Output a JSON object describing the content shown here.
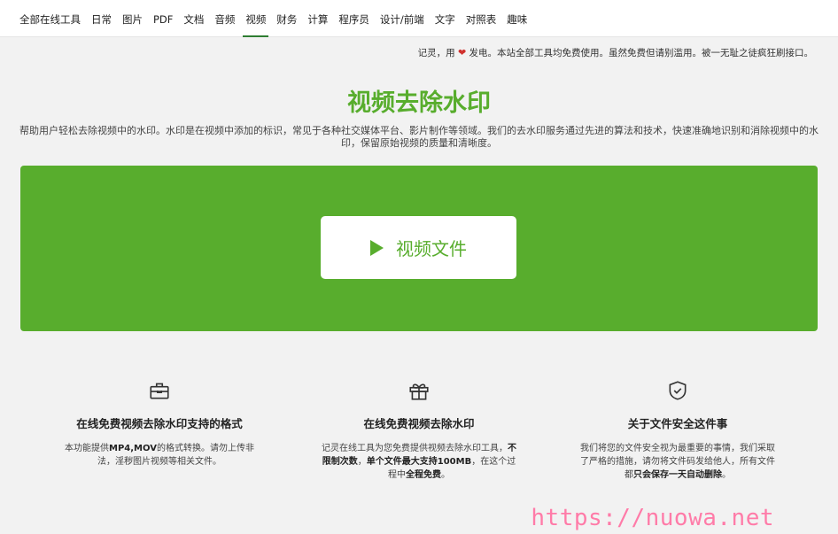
{
  "nav": {
    "items": [
      {
        "label": "全部在线工具"
      },
      {
        "label": "日常"
      },
      {
        "label": "图片"
      },
      {
        "label": "PDF"
      },
      {
        "label": "文档"
      },
      {
        "label": "音频"
      },
      {
        "label": "视频",
        "active": true
      },
      {
        "label": "财务"
      },
      {
        "label": "计算"
      },
      {
        "label": "程序员"
      },
      {
        "label": "设计/前端"
      },
      {
        "label": "文字"
      },
      {
        "label": "对照表"
      },
      {
        "label": "趣味"
      }
    ]
  },
  "notice": {
    "prefix": "记灵，用",
    "suffix": "发电。本站全部工具均免费使用。虽然免费但请别滥用。被一无耻之徒疯狂刷接口。"
  },
  "page": {
    "title": "视频去除水印",
    "description": "帮助用户轻松去除视频中的水印。水印是在视频中添加的标识，常见于各种社交媒体平台、影片制作等领域。我们的去水印服务通过先进的算法和技术，快速准确地识别和消除视频中的水印，保留原始视频的质量和清晰度。"
  },
  "upload": {
    "label": "视频文件"
  },
  "features": [
    {
      "icon": "toolbox-icon",
      "title": "在线免费视频去除水印支持的格式",
      "text_parts": [
        {
          "t": "本功能提供",
          "b": false
        },
        {
          "t": "MP4,MOV",
          "b": true
        },
        {
          "t": "的格式转换。请勿上传非法，淫秽图片视频等相关文件。",
          "b": false
        }
      ]
    },
    {
      "icon": "gift-icon",
      "title": "在线免费视频去除水印",
      "text_parts": [
        {
          "t": "记灵在线工具为您免费提供视频去除水印工具，",
          "b": false
        },
        {
          "t": "不限制次数",
          "b": true
        },
        {
          "t": "，",
          "b": false
        },
        {
          "t": "单个文件最大支持100MB",
          "b": true
        },
        {
          "t": "，在这个过程中",
          "b": false
        },
        {
          "t": "全程免费",
          "b": true
        },
        {
          "t": "。",
          "b": false
        }
      ]
    },
    {
      "icon": "shield-check-icon",
      "title": "关于文件安全这件事",
      "text_parts": [
        {
          "t": "我们将您的文件安全视为最重要的事情，我们采取了严格的措施，请勿将文件码发给他人，所有文件都",
          "b": false
        },
        {
          "t": "只会保存一天自动删除",
          "b": true
        },
        {
          "t": "。",
          "b": false
        }
      ]
    }
  ],
  "watermark": "https://nuowa.net",
  "colors": {
    "brand_green": "#58ad2d",
    "watermark_pink": "#ff7ba8",
    "heart_red": "#d0312d"
  }
}
